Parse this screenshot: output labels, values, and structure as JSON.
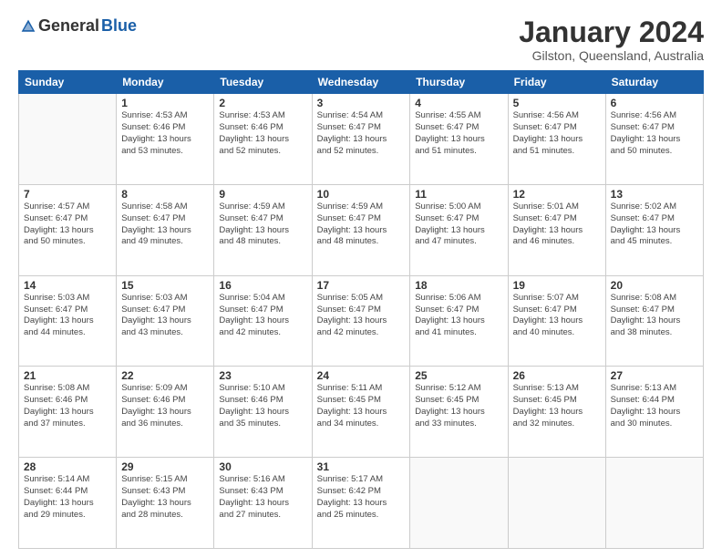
{
  "header": {
    "logo_general": "General",
    "logo_blue": "Blue",
    "month_title": "January 2024",
    "location": "Gilston, Queensland, Australia"
  },
  "columns": [
    "Sunday",
    "Monday",
    "Tuesday",
    "Wednesday",
    "Thursday",
    "Friday",
    "Saturday"
  ],
  "weeks": [
    [
      {
        "num": "",
        "info": ""
      },
      {
        "num": "1",
        "info": "Sunrise: 4:53 AM\nSunset: 6:46 PM\nDaylight: 13 hours\nand 53 minutes."
      },
      {
        "num": "2",
        "info": "Sunrise: 4:53 AM\nSunset: 6:46 PM\nDaylight: 13 hours\nand 52 minutes."
      },
      {
        "num": "3",
        "info": "Sunrise: 4:54 AM\nSunset: 6:47 PM\nDaylight: 13 hours\nand 52 minutes."
      },
      {
        "num": "4",
        "info": "Sunrise: 4:55 AM\nSunset: 6:47 PM\nDaylight: 13 hours\nand 51 minutes."
      },
      {
        "num": "5",
        "info": "Sunrise: 4:56 AM\nSunset: 6:47 PM\nDaylight: 13 hours\nand 51 minutes."
      },
      {
        "num": "6",
        "info": "Sunrise: 4:56 AM\nSunset: 6:47 PM\nDaylight: 13 hours\nand 50 minutes."
      }
    ],
    [
      {
        "num": "7",
        "info": "Sunrise: 4:57 AM\nSunset: 6:47 PM\nDaylight: 13 hours\nand 50 minutes."
      },
      {
        "num": "8",
        "info": "Sunrise: 4:58 AM\nSunset: 6:47 PM\nDaylight: 13 hours\nand 49 minutes."
      },
      {
        "num": "9",
        "info": "Sunrise: 4:59 AM\nSunset: 6:47 PM\nDaylight: 13 hours\nand 48 minutes."
      },
      {
        "num": "10",
        "info": "Sunrise: 4:59 AM\nSunset: 6:47 PM\nDaylight: 13 hours\nand 48 minutes."
      },
      {
        "num": "11",
        "info": "Sunrise: 5:00 AM\nSunset: 6:47 PM\nDaylight: 13 hours\nand 47 minutes."
      },
      {
        "num": "12",
        "info": "Sunrise: 5:01 AM\nSunset: 6:47 PM\nDaylight: 13 hours\nand 46 minutes."
      },
      {
        "num": "13",
        "info": "Sunrise: 5:02 AM\nSunset: 6:47 PM\nDaylight: 13 hours\nand 45 minutes."
      }
    ],
    [
      {
        "num": "14",
        "info": "Sunrise: 5:03 AM\nSunset: 6:47 PM\nDaylight: 13 hours\nand 44 minutes."
      },
      {
        "num": "15",
        "info": "Sunrise: 5:03 AM\nSunset: 6:47 PM\nDaylight: 13 hours\nand 43 minutes."
      },
      {
        "num": "16",
        "info": "Sunrise: 5:04 AM\nSunset: 6:47 PM\nDaylight: 13 hours\nand 42 minutes."
      },
      {
        "num": "17",
        "info": "Sunrise: 5:05 AM\nSunset: 6:47 PM\nDaylight: 13 hours\nand 42 minutes."
      },
      {
        "num": "18",
        "info": "Sunrise: 5:06 AM\nSunset: 6:47 PM\nDaylight: 13 hours\nand 41 minutes."
      },
      {
        "num": "19",
        "info": "Sunrise: 5:07 AM\nSunset: 6:47 PM\nDaylight: 13 hours\nand 40 minutes."
      },
      {
        "num": "20",
        "info": "Sunrise: 5:08 AM\nSunset: 6:47 PM\nDaylight: 13 hours\nand 38 minutes."
      }
    ],
    [
      {
        "num": "21",
        "info": "Sunrise: 5:08 AM\nSunset: 6:46 PM\nDaylight: 13 hours\nand 37 minutes."
      },
      {
        "num": "22",
        "info": "Sunrise: 5:09 AM\nSunset: 6:46 PM\nDaylight: 13 hours\nand 36 minutes."
      },
      {
        "num": "23",
        "info": "Sunrise: 5:10 AM\nSunset: 6:46 PM\nDaylight: 13 hours\nand 35 minutes."
      },
      {
        "num": "24",
        "info": "Sunrise: 5:11 AM\nSunset: 6:45 PM\nDaylight: 13 hours\nand 34 minutes."
      },
      {
        "num": "25",
        "info": "Sunrise: 5:12 AM\nSunset: 6:45 PM\nDaylight: 13 hours\nand 33 minutes."
      },
      {
        "num": "26",
        "info": "Sunrise: 5:13 AM\nSunset: 6:45 PM\nDaylight: 13 hours\nand 32 minutes."
      },
      {
        "num": "27",
        "info": "Sunrise: 5:13 AM\nSunset: 6:44 PM\nDaylight: 13 hours\nand 30 minutes."
      }
    ],
    [
      {
        "num": "28",
        "info": "Sunrise: 5:14 AM\nSunset: 6:44 PM\nDaylight: 13 hours\nand 29 minutes."
      },
      {
        "num": "29",
        "info": "Sunrise: 5:15 AM\nSunset: 6:43 PM\nDaylight: 13 hours\nand 28 minutes."
      },
      {
        "num": "30",
        "info": "Sunrise: 5:16 AM\nSunset: 6:43 PM\nDaylight: 13 hours\nand 27 minutes."
      },
      {
        "num": "31",
        "info": "Sunrise: 5:17 AM\nSunset: 6:42 PM\nDaylight: 13 hours\nand 25 minutes."
      },
      {
        "num": "",
        "info": ""
      },
      {
        "num": "",
        "info": ""
      },
      {
        "num": "",
        "info": ""
      }
    ]
  ]
}
